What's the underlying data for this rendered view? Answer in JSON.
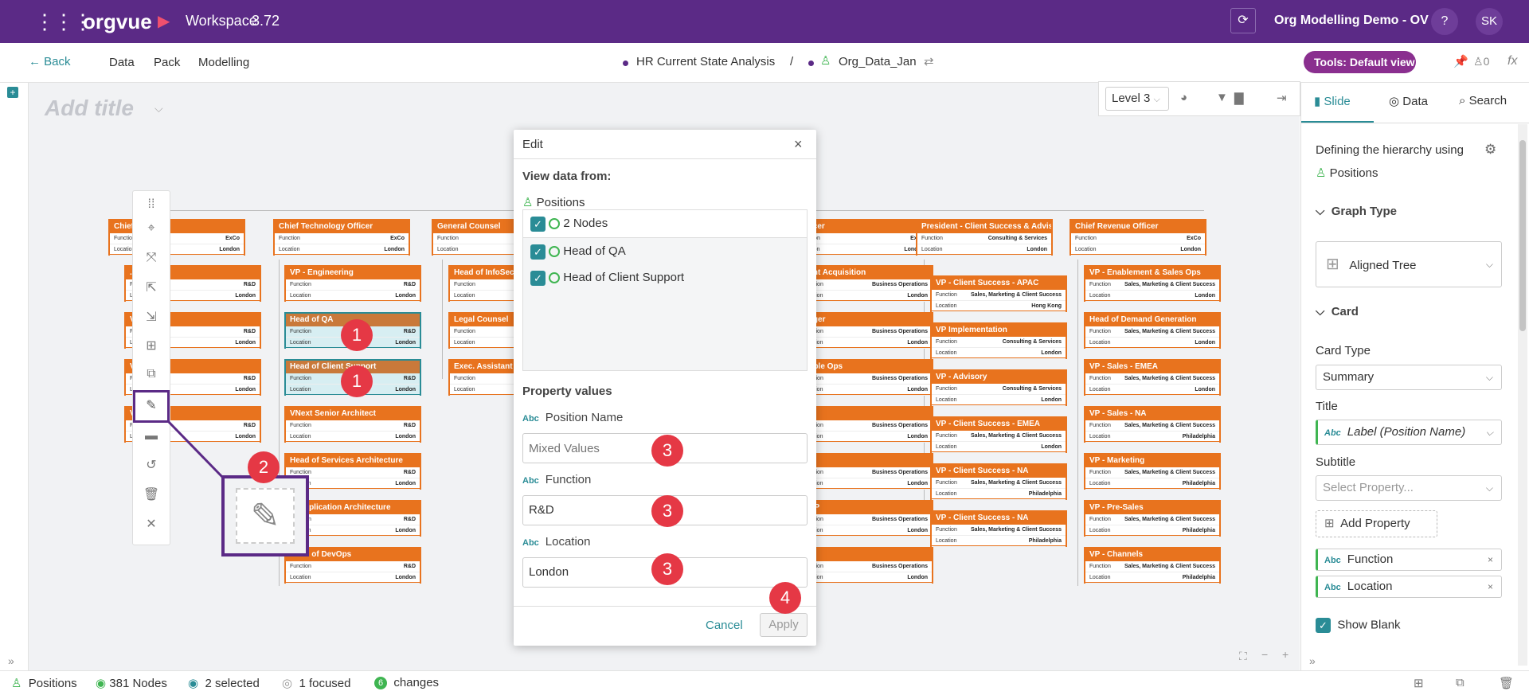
{
  "app": {
    "logo": "orgvue",
    "workspace": "Workspace",
    "version": "3.72",
    "project": "Org Modelling Demo - OV",
    "help": "?",
    "user": "SK"
  },
  "nav": {
    "back": "Back",
    "data": "Data",
    "pack": "Pack",
    "modelling": "Modelling",
    "dataset": "HR Current State Analysis",
    "sep": "/",
    "dataset2": "Org_Data_Jan",
    "tools": "Tools: Default view",
    "count": "0",
    "fx": "fx"
  },
  "canvas": {
    "title_placeholder": "Add title",
    "level": "Level 3"
  },
  "cards": [
    {
      "title": "Chief ... Officer",
      "func": "ExCo",
      "loc": "London"
    },
    {
      "title": "Chief Technology Officer",
      "func": "ExCo",
      "loc": "London"
    },
    {
      "title": "General Counsel",
      "func": "",
      "loc": ""
    },
    {
      "title": "... / UI",
      "func": "R&D",
      "loc": "London"
    },
    {
      "title": "VP - Engineering",
      "func": "R&D",
      "loc": "London"
    },
    {
      "title": "Head of InfoSec",
      "func": "",
      "loc": ""
    },
    {
      "title": "V...t",
      "func": "R&D",
      "loc": "London"
    },
    {
      "title": "Head of QA",
      "func": "R&D",
      "loc": "London"
    },
    {
      "title": "Legal Counsel",
      "func": "",
      "loc": ""
    },
    {
      "title": "V...t",
      "func": "R&D",
      "loc": "London"
    },
    {
      "title": "Head of Client Support",
      "func": "R&D",
      "loc": "London"
    },
    {
      "title": "Exec. Assistant",
      "func": "",
      "loc": ""
    },
    {
      "title": "V...",
      "func": "R&D",
      "loc": "London"
    },
    {
      "title": "VNext Senior Architect",
      "func": "R&D",
      "loc": "London"
    },
    {
      "title": "Head of Services Architecture",
      "func": "R&D",
      "loc": "London"
    },
    {
      "title": "... Application Architecture",
      "func": "R&D",
      "loc": "London"
    },
    {
      "title": "Head of DevOps",
      "func": "R&D",
      "loc": "London"
    },
    {
      "title": "...fficer",
      "func": "ExCo",
      "loc": "London"
    },
    {
      "title": "...ent Acquisition",
      "func": "Business Operations",
      "loc": "London"
    },
    {
      "title": "...ager",
      "func": "Business Operations",
      "loc": "London"
    },
    {
      "title": "...ople Ops",
      "func": "Business Operations",
      "loc": "London"
    },
    {
      "title": "...D",
      "func": "Business Operations",
      "loc": "London"
    },
    {
      "title": "",
      "func": "Business Operations",
      "loc": "London"
    },
    {
      "title": "...BP",
      "func": "Business Operations",
      "loc": "London"
    },
    {
      "title": "",
      "func": "Business Operations",
      "loc": "London"
    },
    {
      "title": "President -  Client Success & Advisory",
      "func": "Consulting & Services",
      "loc": "London"
    },
    {
      "title": "VP - Client Success - APAC",
      "func": "Sales, Marketing & Client Success",
      "loc": "Hong Kong"
    },
    {
      "title": "VP Implementation",
      "func": "Consulting & Services",
      "loc": "London"
    },
    {
      "title": "VP - Advisory",
      "func": "Consulting & Services",
      "loc": "London"
    },
    {
      "title": "VP - Client Success - EMEA",
      "func": "Sales, Marketing & Client Success",
      "loc": "London"
    },
    {
      "title": "VP - Client Success - NA",
      "func": "Sales, Marketing & Client Success",
      "loc": "Philadelphia"
    },
    {
      "title": "VP - Client Success - NA",
      "func": "Sales, Marketing & Client Success",
      "loc": "Philadelphia"
    },
    {
      "title": "Chief Revenue Officer",
      "func": "ExCo",
      "loc": "London"
    },
    {
      "title": "VP - Enablement & Sales Ops",
      "func": "Sales, Marketing & Client Success",
      "loc": "London"
    },
    {
      "title": "Head of Demand Generation",
      "func": "Sales, Marketing & Client Success",
      "loc": "London"
    },
    {
      "title": "VP - Sales - EMEA",
      "func": "Sales, Marketing & Client Success",
      "loc": "London"
    },
    {
      "title": "VP - Sales - NA",
      "func": "Sales, Marketing & Client Success",
      "loc": "Philadelphia"
    },
    {
      "title": "VP - Marketing",
      "func": "Sales, Marketing & Client Success",
      "loc": "Philadelphia"
    },
    {
      "title": "VP - Pre-Sales",
      "func": "Sales, Marketing & Client Success",
      "loc": "Philadelphia"
    },
    {
      "title": "VP - Channels",
      "func": "Sales, Marketing & Client Success",
      "loc": "Philadelphia"
    }
  ],
  "card_labels": {
    "function": "Function",
    "location": "Location"
  },
  "dialog": {
    "title": "Edit",
    "close": "×",
    "view_from": "View data from:",
    "source": "Positions",
    "nodes": "2 Nodes",
    "items": [
      "Head of QA",
      "Head of Client Support"
    ],
    "prop_title": "Property values",
    "props": [
      {
        "label": "Position Name",
        "value": "",
        "placeholder": "Mixed Values"
      },
      {
        "label": "Function",
        "value": "R&D",
        "placeholder": ""
      },
      {
        "label": "Location",
        "value": "London",
        "placeholder": ""
      }
    ],
    "abc": "Abc",
    "cancel": "Cancel",
    "apply": "Apply"
  },
  "markers": [
    "1",
    "1",
    "2",
    "3",
    "3",
    "3",
    "4"
  ],
  "rpanel": {
    "tabs": [
      "Slide",
      "Data",
      "Search"
    ],
    "hierarchy_label": "Defining the hierarchy using",
    "hierarchy_value": "Positions",
    "graph_type_section": "Graph Type",
    "graph_type": "Aligned Tree",
    "card_section": "Card",
    "card_type_label": "Card Type",
    "card_type": "Summary",
    "title_label": "Title",
    "title_value": "Label (Position Name)",
    "subtitle_label": "Subtitle",
    "subtitle_placeholder": "Select Property...",
    "add_property": "Add Property",
    "prop_chips": [
      "Function",
      "Location"
    ],
    "show_blank": "Show Blank"
  },
  "status": {
    "source": "Positions",
    "nodes": "381 Nodes",
    "selected": "2 selected",
    "focused": "1 focused",
    "changes_count": "6",
    "changes": "changes"
  },
  "colors": {
    "brand": "#5b2a86",
    "card": "#e8731e",
    "accent": "#2a8c96",
    "marker": "#e53845"
  }
}
